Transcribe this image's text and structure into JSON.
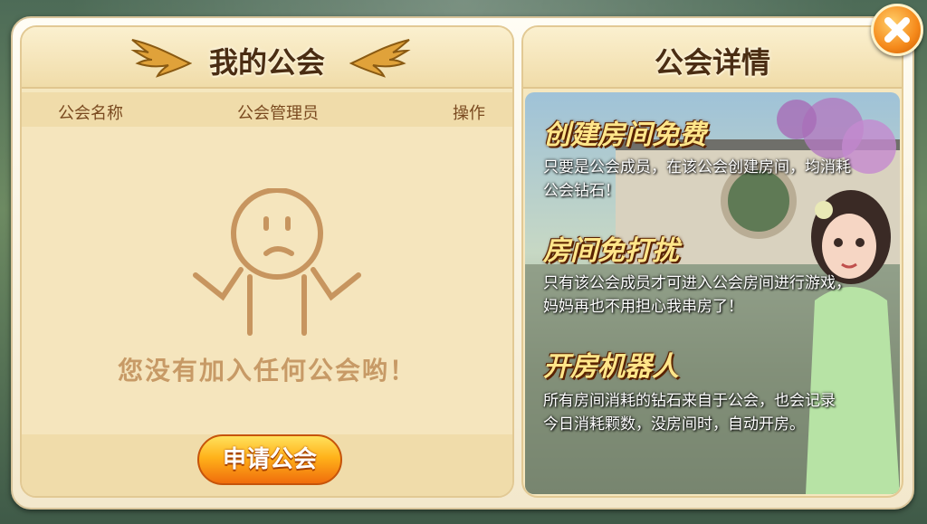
{
  "left_panel": {
    "title": "我的公会",
    "columns": [
      "公会名称",
      "公会管理员",
      "操作"
    ],
    "empty_message": "您没有加入任何公会哟！",
    "apply_button": "申请公会"
  },
  "right_panel": {
    "title": "公会详情",
    "features": [
      {
        "title": "创建房间免费",
        "desc_lines": [
          "只要是公会成员，在该公会创建房间，均消耗",
          "公会钻石！"
        ]
      },
      {
        "title": "房间免打扰",
        "desc_lines": [
          "只有该公会成员才可进入公会房间进行游戏，",
          "妈妈再也不用担心我串房了！"
        ]
      },
      {
        "title": "开房机器人",
        "desc_lines": [
          "所有房间消耗的钻石来自于公会，也会记录",
          "今日消耗颗数，没房间时，自动开房。"
        ]
      }
    ]
  },
  "icons": {
    "close": "close-icon",
    "wings": "golden-wing-icon",
    "empty_state": "shrug-face-icon"
  },
  "colors": {
    "accent_orange": "#f5891a",
    "title_brown": "#4a2d13",
    "empty_text": "#c79a66"
  }
}
